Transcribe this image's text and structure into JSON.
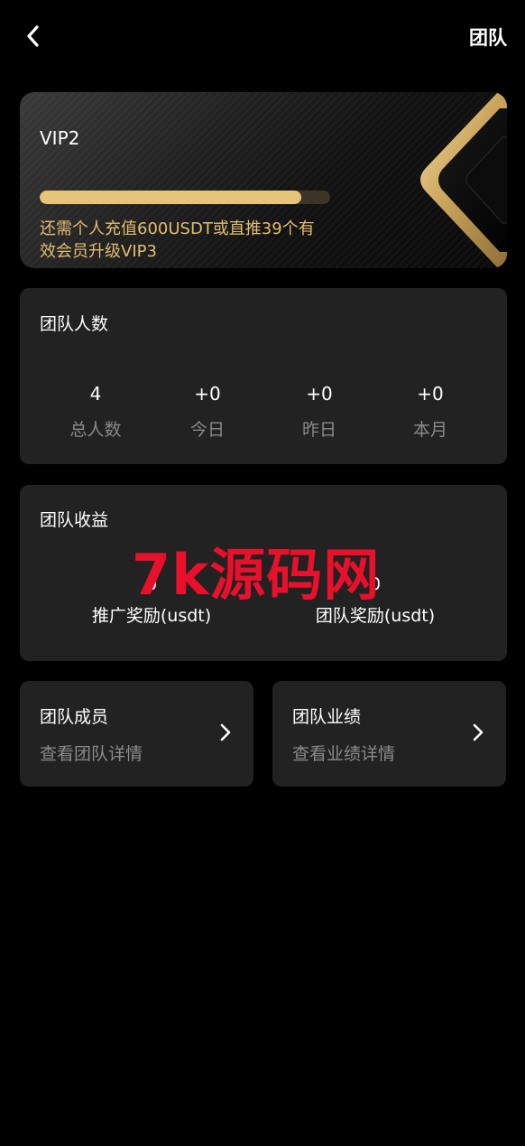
{
  "header": {
    "title": "团队",
    "back_icon": "chevron-left-icon"
  },
  "vip": {
    "level": "VIP2",
    "progress_percent": 90,
    "upgrade_text": "还需个人充值600USDT或直推39个有效会员升级VIP3",
    "accent_color": "#e6c57a",
    "text_color": "#e3bd70"
  },
  "team_count": {
    "title": "团队人数",
    "stats": [
      {
        "value": "4",
        "label": "总人数"
      },
      {
        "value": "+0",
        "label": "今日"
      },
      {
        "value": "+0",
        "label": "昨日"
      },
      {
        "value": "+0",
        "label": "本月"
      }
    ]
  },
  "team_earnings": {
    "title": "团队收益",
    "items": [
      {
        "value": "0",
        "label": "推广奖励(usdt)"
      },
      {
        "value": "0",
        "label": "团队奖励(usdt)"
      }
    ],
    "watermark": "7k源码网"
  },
  "nav": [
    {
      "title": "团队成员",
      "subtitle": "查看团队详情",
      "icon": "chevron-right-icon"
    },
    {
      "title": "团队业绩",
      "subtitle": "查看业绩详情",
      "icon": "chevron-right-icon"
    }
  ]
}
